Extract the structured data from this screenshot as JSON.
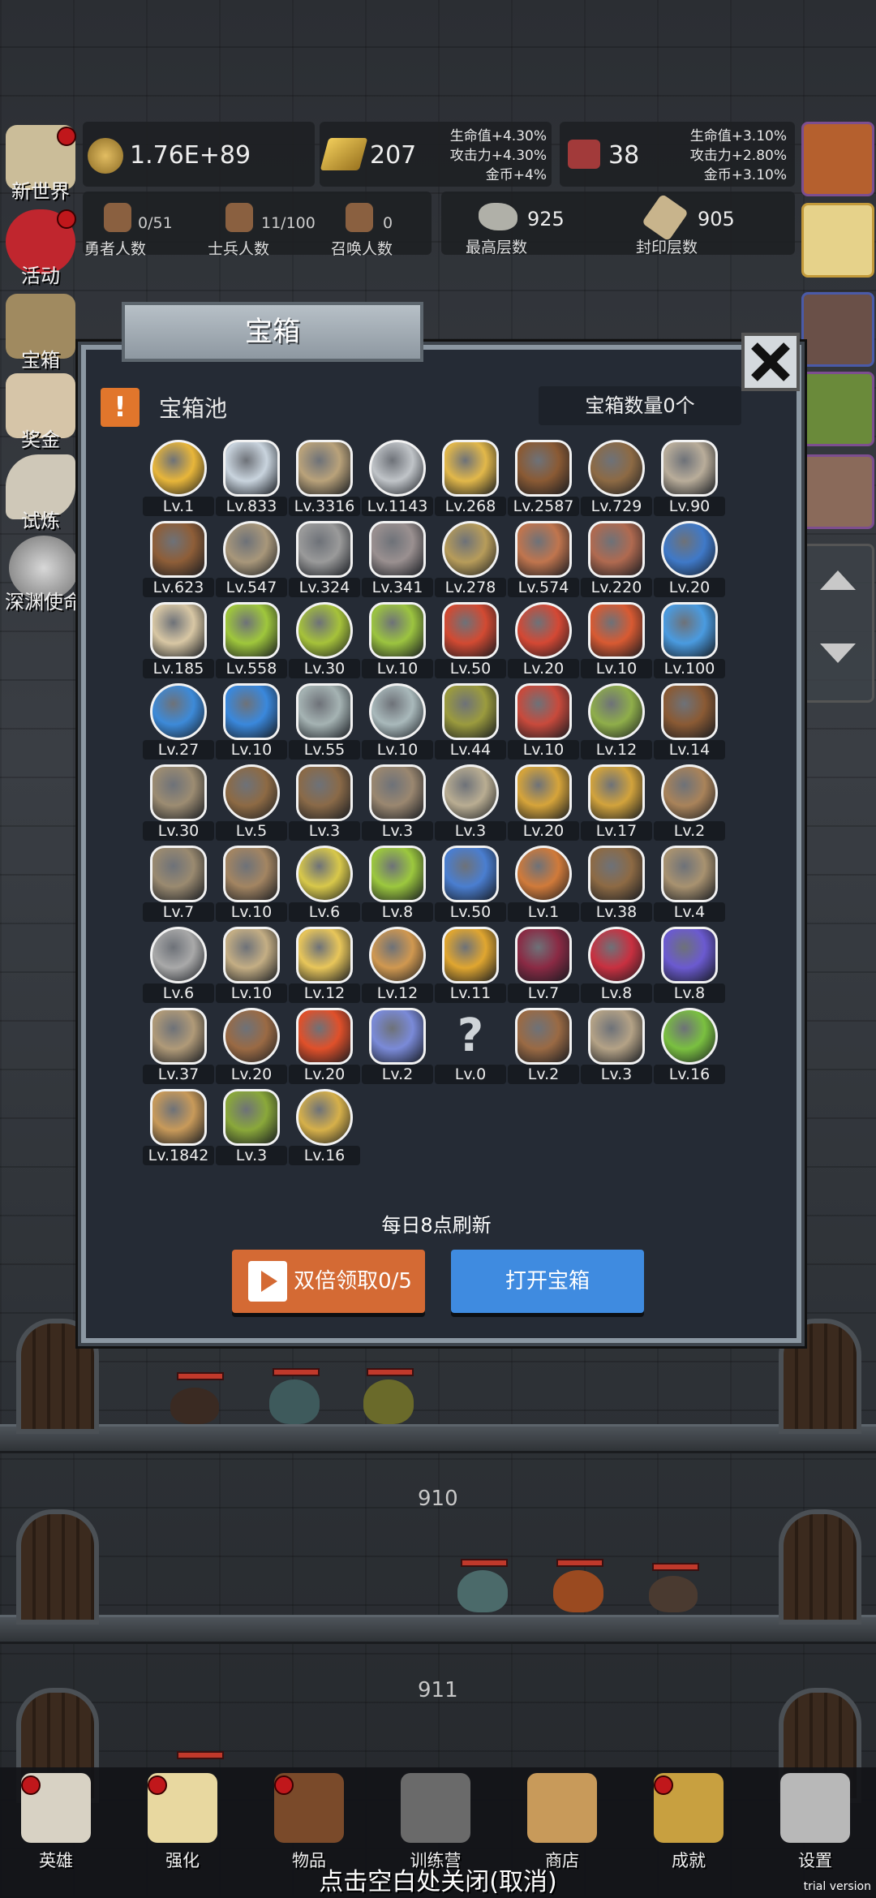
{
  "resources": {
    "coins": "1.76E+89",
    "gold_bars": "207",
    "gold_bonus": [
      "生命值+4.30%",
      "攻击力+4.30%",
      "金币+4%"
    ],
    "meat": "38",
    "meat_bonus": [
      "生命值+3.10%",
      "攻击力+2.80%",
      "金币+3.10%"
    ]
  },
  "counts": {
    "heroes": {
      "value": "0/51",
      "label": "勇者人数"
    },
    "soldiers": {
      "value": "11/100",
      "label": "士兵人数"
    },
    "summons": {
      "value": "0",
      "label": "召唤人数"
    },
    "max_floor": {
      "value": "925",
      "label": "最高层数"
    },
    "sealed_floor": {
      "value": "905",
      "label": "封印层数"
    }
  },
  "left_menu": [
    {
      "label": "新世界",
      "icon": "map-icon",
      "badge": true
    },
    {
      "label": "活动",
      "icon": "heart-icon",
      "badge": true
    },
    {
      "label": "宝箱",
      "icon": "chest-icon",
      "badge": false
    },
    {
      "label": "奖金",
      "icon": "envelope-icon",
      "badge": false
    },
    {
      "label": "试炼",
      "icon": "feather-icon",
      "badge": false
    },
    {
      "label": "深渊使命",
      "icon": "orb-icon",
      "badge": false
    }
  ],
  "modal": {
    "title": "宝箱",
    "pool_title": "宝箱池",
    "chest_count": "宝箱数量0个",
    "refresh_note": "每日8点刷新",
    "double_button": "双倍领取0/5",
    "open_button": "打开宝箱"
  },
  "items": [
    {
      "lv": "Lv.1",
      "icon": "crown-icon",
      "color": "#e8b63a"
    },
    {
      "lv": "Lv.833",
      "icon": "diamond-icon",
      "color": "#c9d4de"
    },
    {
      "lv": "Lv.3316",
      "icon": "sword-icon",
      "color": "#b9a27a"
    },
    {
      "lv": "Lv.1143",
      "icon": "sword-icon",
      "color": "#c0c4c8"
    },
    {
      "lv": "Lv.268",
      "icon": "gold-sword-icon",
      "color": "#e2b84a"
    },
    {
      "lv": "Lv.2587",
      "icon": "leather-armor-icon",
      "color": "#8a5a34"
    },
    {
      "lv": "Lv.729",
      "icon": "backpack-icon",
      "color": "#8d6a44"
    },
    {
      "lv": "Lv.90",
      "icon": "pauldron-icon",
      "color": "#b9ad9a"
    },
    {
      "lv": "Lv.623",
      "icon": "leather-helmet-icon",
      "color": "#8e5e38"
    },
    {
      "lv": "Lv.547",
      "icon": "dagger-icon",
      "color": "#a8977a"
    },
    {
      "lv": "Lv.324",
      "icon": "iron-helmet-icon",
      "color": "#9a9a9a"
    },
    {
      "lv": "Lv.341",
      "icon": "hammer-icon",
      "color": "#9a9090"
    },
    {
      "lv": "Lv.278",
      "icon": "great-helm-icon",
      "color": "#b79c5a"
    },
    {
      "lv": "Lv.574",
      "icon": "ham-icon",
      "color": "#c0754e"
    },
    {
      "lv": "Lv.220",
      "icon": "steak-icon",
      "color": "#b06a50"
    },
    {
      "lv": "Lv.20",
      "icon": "blue-sack-icon",
      "color": "#3f79c8"
    },
    {
      "lv": "Lv.185",
      "icon": "bread-icon",
      "color": "#d8c7a4"
    },
    {
      "lv": "Lv.558",
      "icon": "green-potion-icon",
      "color": "#9fc73c"
    },
    {
      "lv": "Lv.30",
      "icon": "green-potion-icon",
      "color": "#a6c23a"
    },
    {
      "lv": "Lv.10",
      "icon": "green-flask-icon",
      "color": "#9cc440"
    },
    {
      "lv": "Lv.50",
      "icon": "red-potion-icon",
      "color": "#d24a32"
    },
    {
      "lv": "Lv.20",
      "icon": "red-potion-icon",
      "color": "#d44834"
    },
    {
      "lv": "Lv.10",
      "icon": "red-flask-icon",
      "color": "#d85a32"
    },
    {
      "lv": "Lv.100",
      "icon": "blue-potion-icon",
      "color": "#4a9be0"
    },
    {
      "lv": "Lv.27",
      "icon": "blue-potion-icon",
      "color": "#3d8ad8"
    },
    {
      "lv": "Lv.10",
      "icon": "blue-flask-icon",
      "color": "#3a88dc"
    },
    {
      "lv": "Lv.55",
      "icon": "empty-vial-icon",
      "color": "#a5b3b3"
    },
    {
      "lv": "Lv.10",
      "icon": "empty-vial-icon",
      "color": "#a9b9bb"
    },
    {
      "lv": "Lv.44",
      "icon": "olive-vial-icon",
      "color": "#9b9b3e"
    },
    {
      "lv": "Lv.10",
      "icon": "red-vial-icon",
      "color": "#c84a3c"
    },
    {
      "lv": "Lv.12",
      "icon": "winged-boot-icon",
      "color": "#8fae4a"
    },
    {
      "lv": "Lv.14",
      "icon": "leather-boot-icon",
      "color": "#8a5a34"
    },
    {
      "lv": "Lv.30",
      "icon": "boot-icon",
      "color": "#9c8c72"
    },
    {
      "lv": "Lv.5",
      "icon": "round-shield-icon",
      "color": "#8d6a44"
    },
    {
      "lv": "Lv.3",
      "icon": "staff-icon",
      "color": "#8a6a48"
    },
    {
      "lv": "Lv.3",
      "icon": "wooden-shield-icon",
      "color": "#9a8770"
    },
    {
      "lv": "Lv.3",
      "icon": "short-sword-icon",
      "color": "#b9ad92"
    },
    {
      "lv": "Lv.20",
      "icon": "torch-staff-icon",
      "color": "#d6a43a"
    },
    {
      "lv": "Lv.17",
      "icon": "golden-staff-icon",
      "color": "#d2a33c"
    },
    {
      "lv": "Lv.2",
      "icon": "mushroom-icon",
      "color": "#a9835a"
    },
    {
      "lv": "Lv.7",
      "icon": "pickaxe-icon",
      "color": "#9a8a70"
    },
    {
      "lv": "Lv.10",
      "icon": "crook-staff-icon",
      "color": "#a38562"
    },
    {
      "lv": "Lv.6",
      "icon": "lemon-icon",
      "color": "#d8c84a"
    },
    {
      "lv": "Lv.8",
      "icon": "lime-icon",
      "color": "#9cc83e"
    },
    {
      "lv": "Lv.50",
      "icon": "blue-wand-icon",
      "color": "#4a7ed0"
    },
    {
      "lv": "Lv.1",
      "icon": "fire-wand-icon",
      "color": "#d07a3a"
    },
    {
      "lv": "Lv.38",
      "icon": "sack-icon",
      "color": "#8d6a44"
    },
    {
      "lv": "Lv.4",
      "icon": "shovel-icon",
      "color": "#a89270"
    },
    {
      "lv": "Lv.6",
      "icon": "axe-icon",
      "color": "#a9a9a9"
    },
    {
      "lv": "Lv.10",
      "icon": "club-icon",
      "color": "#c4ae84"
    },
    {
      "lv": "Lv.12",
      "icon": "cheese-icon",
      "color": "#e8c65a"
    },
    {
      "lv": "Lv.12",
      "icon": "pie-icon",
      "color": "#d09850"
    },
    {
      "lv": "Lv.11",
      "icon": "honey-jar-icon",
      "color": "#e0a630"
    },
    {
      "lv": "Lv.7",
      "icon": "dark-crystal-icon",
      "color": "#8a2a44"
    },
    {
      "lv": "Lv.8",
      "icon": "red-orb-icon",
      "color": "#c83040"
    },
    {
      "lv": "Lv.8",
      "icon": "gem-cube-icon",
      "color": "#6b5ad0"
    },
    {
      "lv": "Lv.37",
      "icon": "bow-icon",
      "color": "#b09a78"
    },
    {
      "lv": "Lv.20",
      "icon": "quiver-icon",
      "color": "#9a6a44"
    },
    {
      "lv": "Lv.20",
      "icon": "fire-tome-icon",
      "color": "#e0502a"
    },
    {
      "lv": "Lv.2",
      "icon": "ice-gauntlet-icon",
      "color": "#7a8ad8"
    },
    {
      "lv": "Lv.0",
      "icon": "question-mark-icon",
      "color": "#cfd4d8"
    },
    {
      "lv": "Lv.2",
      "icon": "belt-icon",
      "color": "#9a6a44"
    },
    {
      "lv": "Lv.3",
      "icon": "arrow-icon",
      "color": "#b4a286"
    },
    {
      "lv": "Lv.16",
      "icon": "green-wand-icon",
      "color": "#7ac040"
    },
    {
      "lv": "Lv.1842",
      "icon": "beer-mug-icon",
      "color": "#c89a5a"
    },
    {
      "lv": "Lv.3",
      "icon": "herb-icon",
      "color": "#8aa83a"
    },
    {
      "lv": "Lv.16",
      "icon": "gold-pickaxe-icon",
      "color": "#d6b04a"
    }
  ],
  "floors": {
    "upper": "910",
    "lower": "911"
  },
  "bottom_nav": [
    {
      "label": "英雄",
      "icon": "skull-icon",
      "badge": true
    },
    {
      "label": "强化",
      "icon": "candle-icon",
      "badge": true
    },
    {
      "label": "物品",
      "icon": "book-icon",
      "badge": true
    },
    {
      "label": "训练营",
      "icon": "lantern-icon",
      "badge": false
    },
    {
      "label": "商店",
      "icon": "beer-mug-icon",
      "badge": false
    },
    {
      "label": "成就",
      "icon": "key-icon",
      "badge": true
    },
    {
      "label": "设置",
      "icon": "gear-icon",
      "badge": false
    }
  ],
  "close_hint": "点击空白处关闭(取消)",
  "watermark": "trial version"
}
